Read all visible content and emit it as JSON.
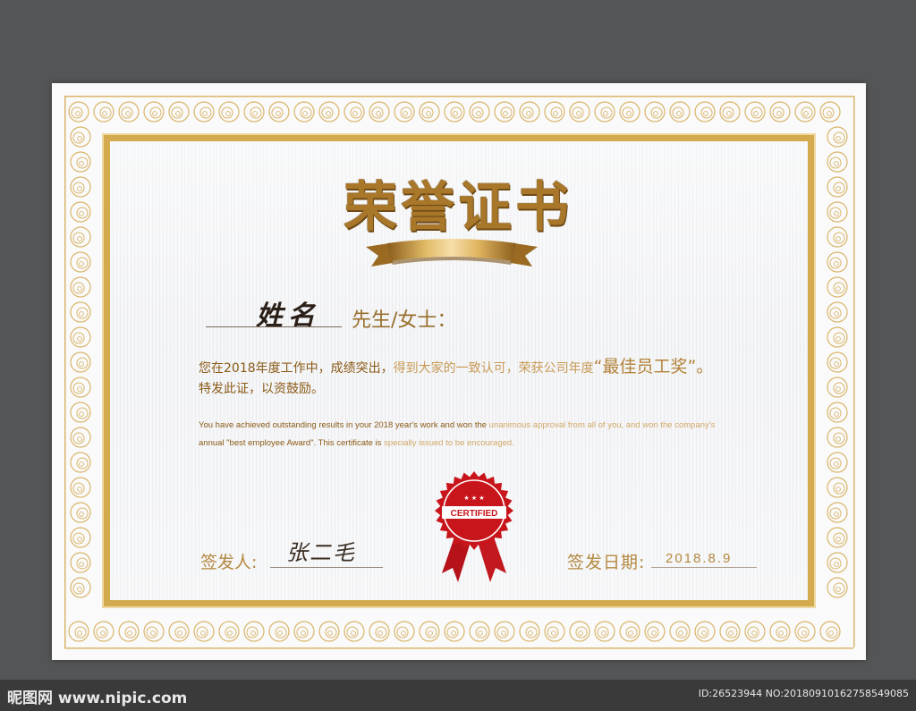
{
  "certificate": {
    "title": "荣誉证书",
    "recipient_name": "姓名",
    "salutation": "先生/女士：",
    "body_cn": {
      "part1": "您在2018年度工作中，成绩突出，",
      "part2": "得到大家的一致认可，荣获公司年度",
      "quote_open": "“",
      "award": "最佳员工奖",
      "quote_close": "”。",
      "line2": "特发此证，以资鼓励。"
    },
    "body_en": {
      "part1": "You have achieved outstanding results in your 2018 year's work and won the ",
      "part2": "unanimous approval from all of you, and won the company's",
      "line2a": "annual \"best employee Award\". This certificate is ",
      "line2b": "specially issued to be encouraged."
    },
    "seal": {
      "text": "CERTIFIED",
      "stars": "★ ★ ★"
    },
    "issuer_label": "签发人:",
    "issuer_signature": "张二毛",
    "date_label": "签发日期:",
    "date_value": "2018.8.9"
  },
  "watermark": {
    "site": "昵图网 www.nipic.com",
    "id_text": "ID:26523944 NO:20180910162758549085"
  },
  "colors": {
    "page_background": "#545556",
    "gold_frame": "#d4aa4f",
    "title_gold": "#a9772a",
    "seal_red": "#c8151b"
  }
}
